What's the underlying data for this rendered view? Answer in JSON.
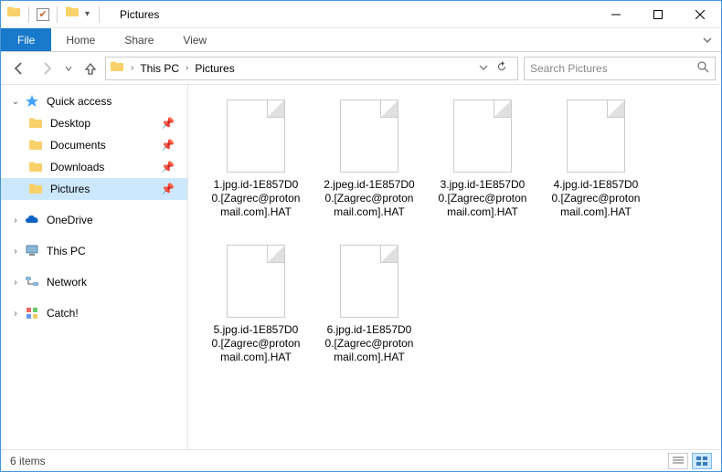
{
  "titlebar": {
    "title": "Pictures"
  },
  "ribbon": {
    "file": "File",
    "tabs": [
      "Home",
      "Share",
      "View"
    ]
  },
  "breadcrumb": {
    "root": "This PC",
    "current": "Pictures"
  },
  "search": {
    "placeholder": "Search Pictures"
  },
  "sidebar": {
    "quickaccess": "Quick access",
    "qa_items": [
      {
        "label": "Desktop"
      },
      {
        "label": "Documents"
      },
      {
        "label": "Downloads"
      },
      {
        "label": "Pictures"
      }
    ],
    "onedrive": "OneDrive",
    "thispc": "This PC",
    "network": "Network",
    "catch": "Catch!"
  },
  "files": [
    {
      "name": "1.jpg.id-1E857D00.[Zagrec@protonmail.com].HAT"
    },
    {
      "name": "2.jpeg.id-1E857D00.[Zagrec@protonmail.com].HAT"
    },
    {
      "name": "3.jpg.id-1E857D00.[Zagrec@protonmail.com].HAT"
    },
    {
      "name": "4.jpg.id-1E857D00.[Zagrec@protonmail.com].HAT"
    },
    {
      "name": "5.jpg.id-1E857D00.[Zagrec@protonmail.com].HAT"
    },
    {
      "name": "6.jpg.id-1E857D00.[Zagrec@protonmail.com].HAT"
    }
  ],
  "statusbar": {
    "count": "6 items"
  }
}
